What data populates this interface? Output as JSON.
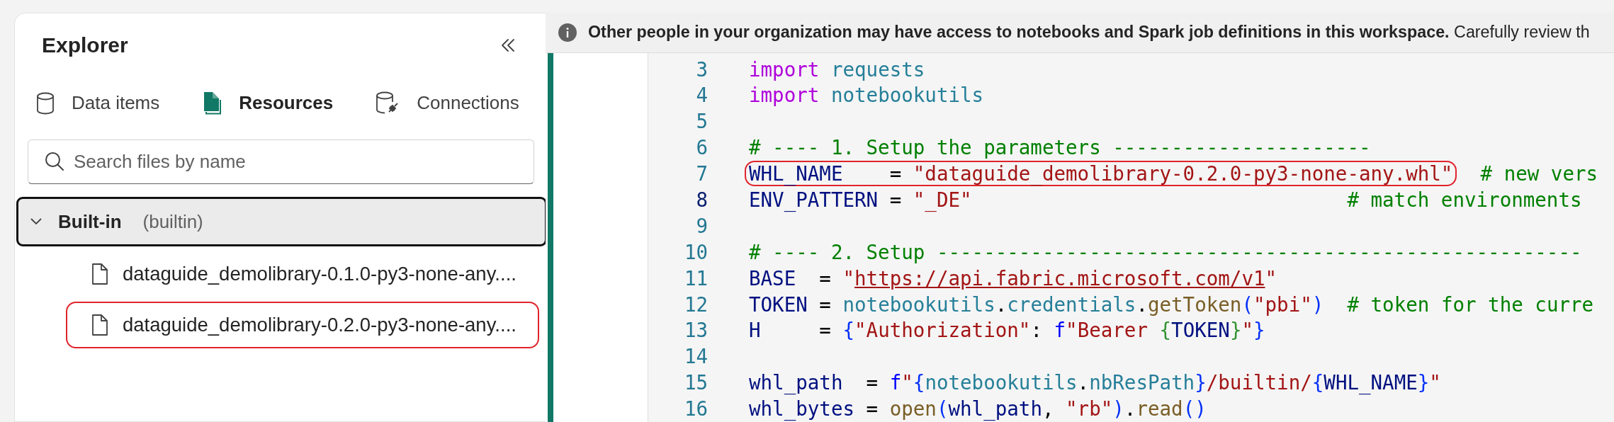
{
  "explorer": {
    "title": "Explorer",
    "tabs": [
      {
        "label": "Data items",
        "selected": false
      },
      {
        "label": "Resources",
        "selected": true
      },
      {
        "label": "Connections",
        "selected": false
      }
    ],
    "search": {
      "placeholder": "Search files by name"
    },
    "tree": [
      {
        "label": "Built-in",
        "detail": "(builtin)",
        "expanded": true,
        "focused": true,
        "children": [
          {
            "label": "dataguide_demolibrary-0.1.0-py3-none-any....",
            "annotated": false
          },
          {
            "label": "dataguide_demolibrary-0.2.0-py3-none-any....",
            "annotated": true
          }
        ]
      }
    ]
  },
  "banner": {
    "text": "**Other people in your organization may have access to notebooks and Spark job definitions in this workspace.** Carefully review th"
  },
  "code": {
    "lines": [
      {
        "number": "3",
        "current": false,
        "tokens": [
          {
            "text": "import",
            "kind": "keyword"
          },
          {
            "text": " requests",
            "kind": "module"
          }
        ]
      },
      {
        "number": "4",
        "current": false,
        "tokens": [
          {
            "text": "import",
            "kind": "keyword"
          },
          {
            "text": " notebookutils",
            "kind": "module"
          }
        ]
      },
      {
        "number": "5",
        "current": false
      },
      {
        "number": "6",
        "current": false,
        "tokens": [
          {
            "text": "# ---- 1. Setup the parameters ----------------------",
            "kind": "comment"
          }
        ]
      },
      {
        "number": "7",
        "current": false,
        "annotated": true,
        "tokens": [
          {
            "text": "WHL_NAME",
            "kind": "variable"
          },
          {
            "text": "    = ",
            "kind": "plain"
          },
          {
            "text": "\"dataguide_demolibrary-0.2.0-py3-none-any.whl\"",
            "kind": "string"
          },
          {
            "text": "  # new vers",
            "kind": "comment"
          }
        ]
      },
      {
        "number": "8",
        "current": true,
        "tokens": [
          {
            "text": "ENV_PATTERN",
            "kind": "variable"
          },
          {
            "text": " = ",
            "kind": "plain"
          },
          {
            "text": "\"_DE\"",
            "kind": "string"
          },
          {
            "text": "                                # match environments",
            "kind": "comment"
          }
        ]
      },
      {
        "number": "9",
        "current": false
      },
      {
        "number": "10",
        "current": false,
        "tokens": [
          {
            "text": "# ---- 2. Setup -------------------------------------------------------",
            "kind": "comment"
          }
        ]
      },
      {
        "number": "11",
        "current": false,
        "tokens": [
          {
            "text": "BASE",
            "kind": "variable"
          },
          {
            "text": "  = ",
            "kind": "plain"
          },
          {
            "text": "\"",
            "kind": "string"
          },
          {
            "text": "https://api.fabric.microsoft.com/v1",
            "kind": "url"
          },
          {
            "text": "\"",
            "kind": "string"
          }
        ]
      },
      {
        "number": "12",
        "current": false,
        "tokens": [
          {
            "text": "TOKEN",
            "kind": "variable"
          },
          {
            "text": " = ",
            "kind": "plain"
          },
          {
            "text": "notebookutils",
            "kind": "module"
          },
          {
            "text": ".",
            "kind": "plain"
          },
          {
            "text": "credentials",
            "kind": "module"
          },
          {
            "text": ".",
            "kind": "plain"
          },
          {
            "text": "getToken",
            "kind": "function"
          },
          {
            "text": "(",
            "kind": "bracket"
          },
          {
            "text": "\"pbi\"",
            "kind": "string"
          },
          {
            "text": ")",
            "kind": "bracket"
          },
          {
            "text": "  # token for the curre",
            "kind": "comment"
          }
        ]
      },
      {
        "number": "13",
        "current": false,
        "tokens": [
          {
            "text": "H",
            "kind": "variable"
          },
          {
            "text": "     = ",
            "kind": "plain"
          },
          {
            "text": "{",
            "kind": "bracket"
          },
          {
            "text": "\"Authorization\"",
            "kind": "string"
          },
          {
            "text": ": ",
            "kind": "plain"
          },
          {
            "text": "f",
            "kind": "prefix"
          },
          {
            "text": "\"Bearer ",
            "kind": "string"
          },
          {
            "text": "{",
            "kind": "bracket2"
          },
          {
            "text": "TOKEN",
            "kind": "variable"
          },
          {
            "text": "}",
            "kind": "bracket2"
          },
          {
            "text": "\"",
            "kind": "string"
          },
          {
            "text": "}",
            "kind": "bracket"
          }
        ]
      },
      {
        "number": "14",
        "current": false
      },
      {
        "number": "15",
        "current": false,
        "tokens": [
          {
            "text": "whl_path",
            "kind": "variable"
          },
          {
            "text": "  = ",
            "kind": "plain"
          },
          {
            "text": "f",
            "kind": "prefix"
          },
          {
            "text": "\"",
            "kind": "string"
          },
          {
            "text": "{",
            "kind": "bracket"
          },
          {
            "text": "notebookutils",
            "kind": "module"
          },
          {
            "text": ".",
            "kind": "plain"
          },
          {
            "text": "nbResPath",
            "kind": "module"
          },
          {
            "text": "}",
            "kind": "bracket"
          },
          {
            "text": "/builtin/",
            "kind": "string"
          },
          {
            "text": "{",
            "kind": "bracket"
          },
          {
            "text": "WHL_NAME",
            "kind": "variable"
          },
          {
            "text": "}",
            "kind": "bracket"
          },
          {
            "text": "\"",
            "kind": "string"
          }
        ]
      },
      {
        "number": "16",
        "current": false,
        "tokens": [
          {
            "text": "whl_bytes",
            "kind": "variable"
          },
          {
            "text": " = ",
            "kind": "plain"
          },
          {
            "text": "open",
            "kind": "function"
          },
          {
            "text": "(",
            "kind": "bracket"
          },
          {
            "text": "whl_path",
            "kind": "variable"
          },
          {
            "text": ", ",
            "kind": "plain"
          },
          {
            "text": "\"rb\"",
            "kind": "string"
          },
          {
            "text": ")",
            "kind": "bracket"
          },
          {
            "text": ".",
            "kind": "plain"
          },
          {
            "text": "read",
            "kind": "function"
          },
          {
            "text": "(",
            "kind": "bracket"
          },
          {
            "text": ")",
            "kind": "bracket"
          }
        ]
      }
    ]
  }
}
